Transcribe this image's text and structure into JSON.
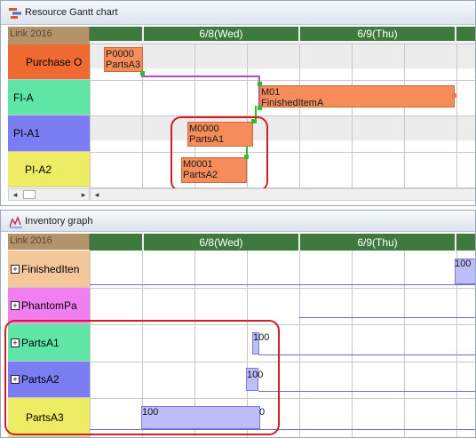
{
  "gantt": {
    "title": "Resource Gantt chart",
    "corner_link": "Link",
    "corner_year": "2016",
    "dates": [
      "6/8(Wed)",
      "6/9(Thu)"
    ],
    "rows": [
      {
        "label": "Purchase O",
        "color": "#ee6a30"
      },
      {
        "label": "FI-A",
        "color": "#5fe6a6"
      },
      {
        "label": "PI-A1",
        "color": "#7a7ef2"
      },
      {
        "label": "PI-A2",
        "color": "#eeeb64"
      }
    ],
    "tasks": [
      {
        "id": "P0000",
        "item": "PartsA3"
      },
      {
        "id": "M01",
        "item": "FinishedItemA"
      },
      {
        "id": "M0000",
        "item": "PartsA1"
      },
      {
        "id": "M0001",
        "item": "PartsA2"
      }
    ],
    "scroll_left": "◂",
    "scroll_right": "▸",
    "scroll_left2": "◂"
  },
  "inventory": {
    "title": "Inventory graph",
    "corner_link": "Link",
    "corner_year": "2016",
    "dates": [
      "6/8(Wed)",
      "6/9(Thu)"
    ],
    "expander_symbol": "+",
    "rows": [
      {
        "label": "FinishedIten",
        "color": "#f4c79a",
        "expandable": true
      },
      {
        "label": "PhantomPa",
        "color": "#f27ff2",
        "expandable": true
      },
      {
        "label": "PartsA1",
        "color": "#5fe6a6",
        "expandable": true
      },
      {
        "label": "PartsA2",
        "color": "#7a7ef2",
        "expandable": true
      },
      {
        "label": "PartsA3",
        "color": "#eeeb64",
        "expandable": false
      }
    ],
    "values": {
      "finished": "100",
      "partsA1": "100",
      "partsA2": "100",
      "partsA3_start": "100",
      "partsA3_end": "0"
    }
  },
  "colors": {
    "callout": "#d31d24",
    "task_fill": "#f58c5a",
    "link_line": "#b04cc7",
    "pin": "#2ebd2e",
    "inventory_bar": "#bdbdf7"
  }
}
